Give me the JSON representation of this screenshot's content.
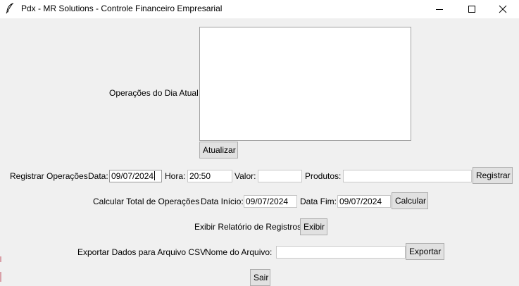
{
  "window": {
    "title": "Pdx - MR Solutions - Controle Financeiro Empresarial",
    "icon": "feather-icon"
  },
  "operacoes_dia": {
    "label": "Operações do Dia Atual",
    "items": [],
    "refresh_button": "Atualizar"
  },
  "registrar": {
    "label": "Registrar Operações",
    "data_label": "Data:",
    "data_value": "09/07/2024",
    "hora_label": "Hora:",
    "hora_value": "20:50",
    "valor_label": "Valor:",
    "valor_value": "",
    "produtos_label": "Produtos:",
    "produtos_value": "",
    "button": "Registrar"
  },
  "calcular": {
    "label": "Calcular Total de Operações",
    "inicio_label": "Data Início:",
    "inicio_value": "09/07/2024",
    "fim_label": "Data Fim:",
    "fim_value": "09/07/2024",
    "button": "Calcular"
  },
  "relatorio": {
    "label": "Exibir Relatório de Registros",
    "button": "Exibir"
  },
  "exportar": {
    "label": "Exportar Dados para Arquivo CSV",
    "nome_label": "Nome do Arquivo:",
    "nome_value": "",
    "button": "Exportar"
  },
  "sair": {
    "button": "Sair"
  }
}
